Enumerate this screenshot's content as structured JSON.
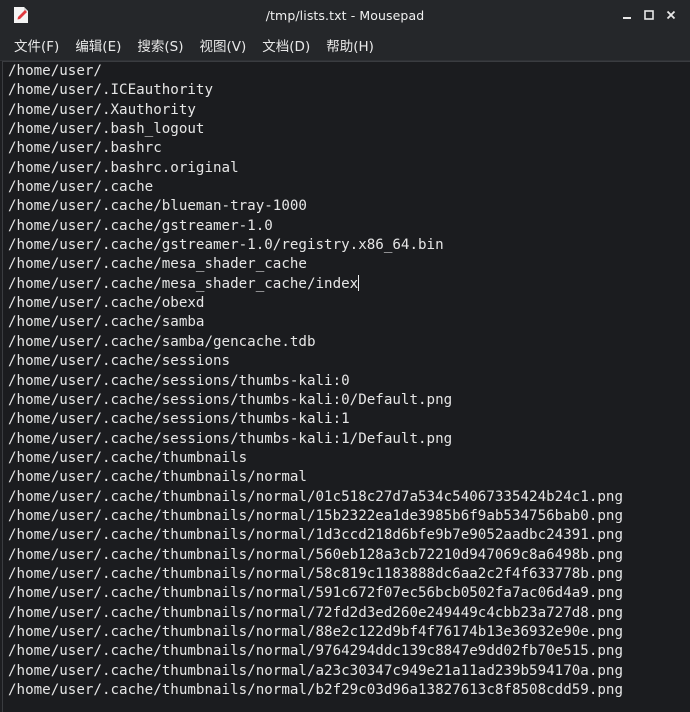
{
  "window": {
    "title": "/tmp/lists.txt - Mousepad",
    "app_icon": "mousepad-document-icon",
    "controls": {
      "minimize_icon": "minimize-icon",
      "maximize_icon": "maximize-icon",
      "close_icon": "close-icon"
    }
  },
  "menu": [
    {
      "label": "文件(F)"
    },
    {
      "label": "编辑(E)"
    },
    {
      "label": "搜索(S)"
    },
    {
      "label": "视图(V)"
    },
    {
      "label": "文档(D)"
    },
    {
      "label": "帮助(H)"
    }
  ],
  "editor": {
    "caret_line": 11,
    "lines": [
      "/home/user/",
      "/home/user/.ICEauthority",
      "/home/user/.Xauthority",
      "/home/user/.bash_logout",
      "/home/user/.bashrc",
      "/home/user/.bashrc.original",
      "/home/user/.cache",
      "/home/user/.cache/blueman-tray-1000",
      "/home/user/.cache/gstreamer-1.0",
      "/home/user/.cache/gstreamer-1.0/registry.x86_64.bin",
      "/home/user/.cache/mesa_shader_cache",
      "/home/user/.cache/mesa_shader_cache/index",
      "/home/user/.cache/obexd",
      "/home/user/.cache/samba",
      "/home/user/.cache/samba/gencache.tdb",
      "/home/user/.cache/sessions",
      "/home/user/.cache/sessions/thumbs-kali:0",
      "/home/user/.cache/sessions/thumbs-kali:0/Default.png",
      "/home/user/.cache/sessions/thumbs-kali:1",
      "/home/user/.cache/sessions/thumbs-kali:1/Default.png",
      "/home/user/.cache/thumbnails",
      "/home/user/.cache/thumbnails/normal",
      "/home/user/.cache/thumbnails/normal/01c518c27d7a534c54067335424b24c1.png",
      "/home/user/.cache/thumbnails/normal/15b2322ea1de3985b6f9ab534756bab0.png",
      "/home/user/.cache/thumbnails/normal/1d3ccd218d6bfe9b7e9052aadbc24391.png",
      "/home/user/.cache/thumbnails/normal/560eb128a3cb72210d947069c8a6498b.png",
      "/home/user/.cache/thumbnails/normal/58c819c1183888dc6aa2c2f4f633778b.png",
      "/home/user/.cache/thumbnails/normal/591c672f07ec56bcb0502fa7ac06d4a9.png",
      "/home/user/.cache/thumbnails/normal/72fd2d3ed260e249449c4cbb23a727d8.png",
      "/home/user/.cache/thumbnails/normal/88e2c122d9bf4f76174b13e36932e90e.png",
      "/home/user/.cache/thumbnails/normal/9764294ddc139c8847e9dd02fb70e515.png",
      "/home/user/.cache/thumbnails/normal/a23c30347c949e21a11ad239b594170a.png",
      "/home/user/.cache/thumbnails/normal/b2f29c03d96a13827613c8f8508cdd59.png"
    ]
  },
  "colors": {
    "background": "#1b1c1f",
    "chrome": "#25272a",
    "text": "#e6e6e6",
    "icon_red": "#e0393e"
  }
}
